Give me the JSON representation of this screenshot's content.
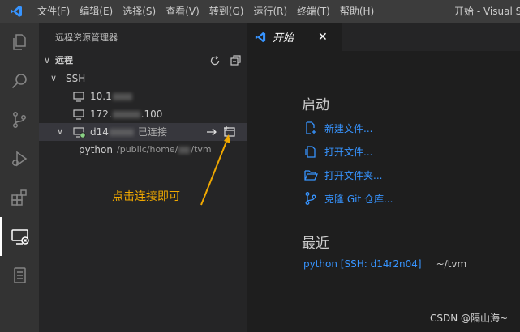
{
  "titlebar": {
    "menus": [
      "文件(F)",
      "编辑(E)",
      "选择(S)",
      "查看(V)",
      "转到(G)",
      "运行(R)",
      "终端(T)",
      "帮助(H)"
    ],
    "window_title": "开始 - Visual S"
  },
  "activity_bar": {
    "items": [
      "explorer-icon",
      "search-icon",
      "source-control-icon",
      "run-debug-icon",
      "extensions-icon",
      "remote-explorer-icon",
      "remote-cube-icon"
    ],
    "active": "remote-explorer-icon"
  },
  "sidebar": {
    "title": "远程资源管理器",
    "section_label": "远程",
    "ssh_label": "SSH",
    "hosts": [
      {
        "name": "10.1",
        "status": ""
      },
      {
        "name": "172.",
        "suffix": ".100",
        "status": ""
      },
      {
        "name": "d14",
        "status": "已连接"
      }
    ],
    "folder": {
      "name": "python",
      "path_prefix": "/public/home/",
      "path_suffix": "/tvm"
    }
  },
  "annotation": {
    "text": "点击连接即可",
    "color": "#f0a800"
  },
  "editor": {
    "tab_label": "开始",
    "start_heading": "启动",
    "actions": [
      "新建文件...",
      "打开文件...",
      "打开文件夹...",
      "克隆 Git 仓库..."
    ],
    "recent_heading": "最近",
    "recent": [
      {
        "name": "python [SSH: d14r2n04]",
        "path": "~/tvm"
      }
    ]
  },
  "watermark": "CSDN @隔山海~",
  "colors": {
    "accent": "#3794ff",
    "vscode_blue": "#3794ff",
    "connected_green": "#89d185"
  }
}
